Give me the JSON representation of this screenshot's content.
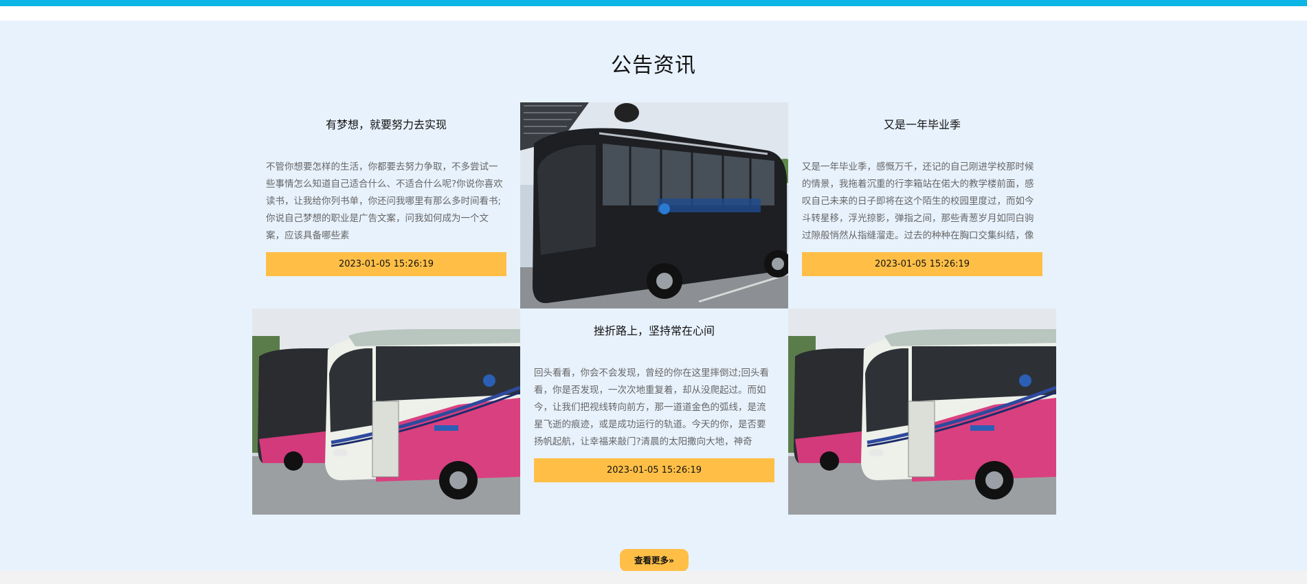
{
  "section": {
    "title": "公告资讯"
  },
  "cards": [
    {
      "title": "有梦想，就要努力去实现",
      "body": "不管你想要怎样的生活，你都要去努力争取，不多尝试一些事情怎么知道自己适合什么、不适合什么呢?你说你喜欢读书，让我给你列书单，你还问我哪里有那么多时间看书;你说自己梦想的职业是广告文案，问我如何成为一个文案，应该具备哪些素",
      "date": "2023-01-05 15:26:19"
    },
    {
      "title": "又是一年毕业季",
      "body": "又是一年毕业季，感慨万千，还记的自己刚进学校那时候的情景，我拖着沉重的行李箱站在偌大的教学楼前面，感叹自己未来的日子即将在这个陌生的校园里度过，而如今斗转星移，浮光掠影，弹指之间，那些青葱岁月如同白驹过隙般悄然从指缝溜走。过去的种种在胸口交集纠结，像",
      "date": "2023-01-05 15:26:19"
    },
    {
      "title": "挫折路上，坚持常在心间",
      "body": "回头看看，你会不会发现，曾经的你在这里摔倒过;回头看看，你是否发现，一次次地重复着，却从没爬起过。而如今，让我们把视线转向前方，那一道道金色的弧线，是流星飞逝的痕迹，或是成功运行的轨道。今天的你，是否要扬帆起航，让幸福来敲门?清晨的太阳撒向大地，神奇",
      "date": "2023-01-05 15:26:19"
    }
  ],
  "more_button": {
    "label": "查看更多",
    "icon": "double-chevron-right-icon"
  },
  "colors": {
    "topbar": "#0bb6e6",
    "section_bg": "#e8f2fd",
    "accent": "#ffbf47"
  }
}
